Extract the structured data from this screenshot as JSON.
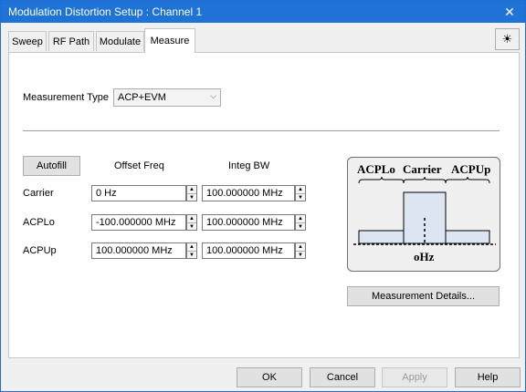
{
  "window": {
    "title": "Modulation Distortion Setup : Channel 1",
    "close_glyph": "✕"
  },
  "tabs": [
    {
      "label": "Sweep",
      "active": false
    },
    {
      "label": "RF Path",
      "active": false
    },
    {
      "label": "Modulate",
      "active": false
    },
    {
      "label": "Measure",
      "active": true
    }
  ],
  "toolbar": {
    "sun_icon": "☀"
  },
  "measure": {
    "measurement_type_label": "Measurement Type",
    "measurement_type_value": "ACP+EVM",
    "autofill_label": "Autofill",
    "col_offset_freq": "Offset Freq",
    "col_integ_bw": "Integ BW",
    "rows": [
      {
        "label": "Carrier",
        "offset": "0 Hz",
        "bw": "100.000000 MHz"
      },
      {
        "label": "ACPLo",
        "offset": "-100.000000 MHz",
        "bw": "100.000000 MHz"
      },
      {
        "label": "ACPUp",
        "offset": "100.000000 MHz",
        "bw": "100.000000 MHz"
      }
    ],
    "diagram": {
      "label_acplo": "ACPLo",
      "label_carrier": "Carrier",
      "label_acpup": "ACPUp",
      "label_center": "oHz"
    },
    "details_button": "Measurement Details..."
  },
  "footer": {
    "ok": "OK",
    "cancel": "Cancel",
    "apply": "Apply",
    "help": "Help"
  }
}
